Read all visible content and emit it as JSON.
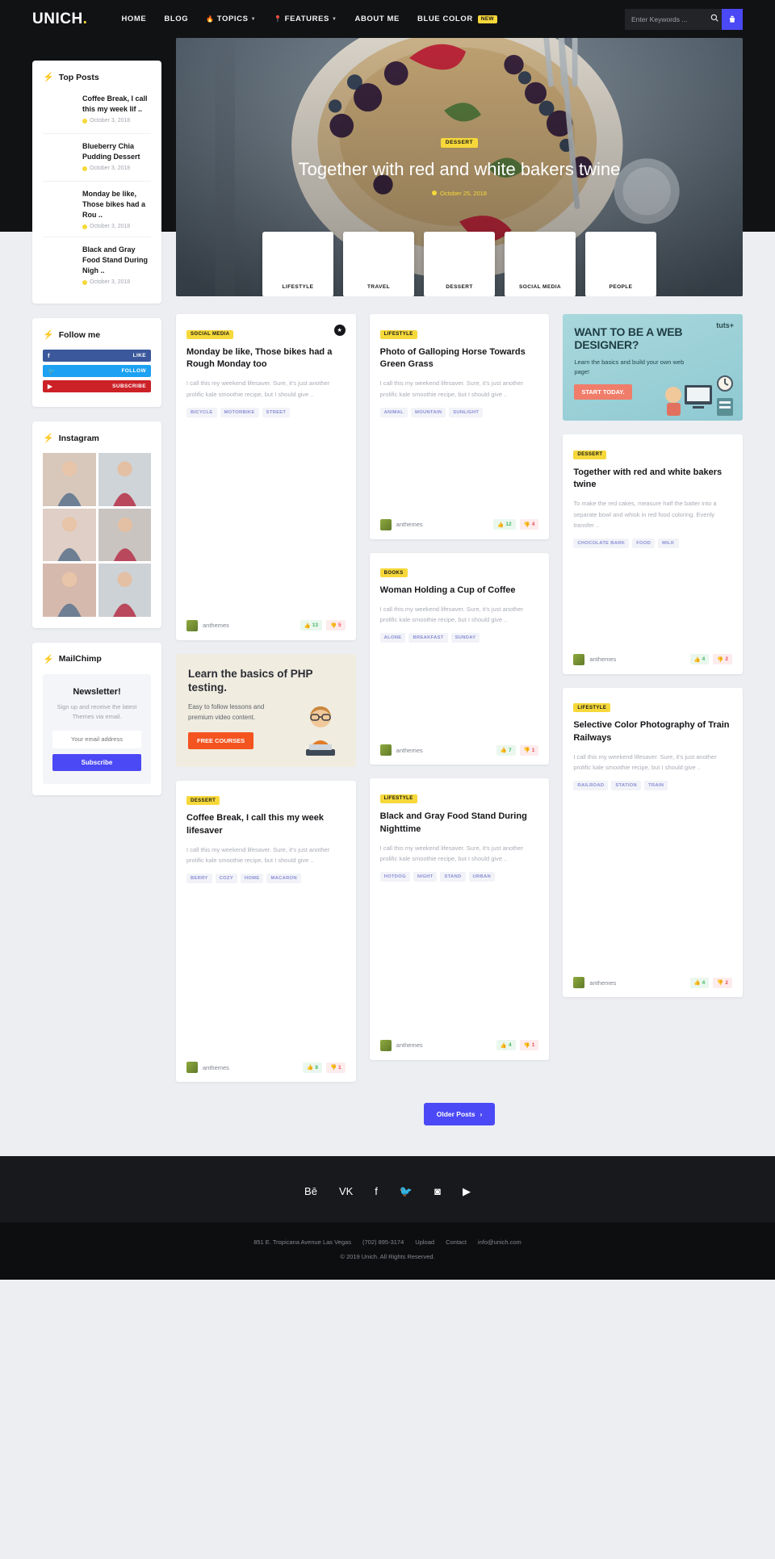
{
  "header": {
    "logo": "UNICH",
    "logo_dot": ".",
    "nav": [
      {
        "label": "HOME",
        "icon": "",
        "caret": false,
        "badge": ""
      },
      {
        "label": "BLOG",
        "icon": "",
        "caret": false,
        "badge": ""
      },
      {
        "label": "TOPICS",
        "icon": "flame-icon",
        "caret": true,
        "badge": ""
      },
      {
        "label": "FEATURES",
        "icon": "pin-icon",
        "caret": true,
        "badge": ""
      },
      {
        "label": "ABOUT ME",
        "icon": "",
        "caret": false,
        "badge": ""
      },
      {
        "label": "BLUE COLOR",
        "icon": "",
        "caret": false,
        "badge": "NEW"
      }
    ],
    "search_placeholder": "Enter Keywords ...",
    "search_value": "",
    "accent": "#4b49f5",
    "yellow": "#f6d83a"
  },
  "sidebar": {
    "top_posts": {
      "title": "Top Posts",
      "items": [
        {
          "title": "Coffee Break, I call this my week lif ..",
          "date": "October 3, 2018"
        },
        {
          "title": "Blueberry Chia Pudding Dessert",
          "date": "October 3, 2018"
        },
        {
          "title": "Monday be like, Those bikes had a Rou ..",
          "date": "October 3, 2018"
        },
        {
          "title": "Black and Gray Food Stand During Nigh ..",
          "date": "October 3, 2018"
        }
      ]
    },
    "follow": {
      "title": "Follow me",
      "buttons": [
        {
          "network": "facebook",
          "label": "LIKE",
          "glyph": "f"
        },
        {
          "network": "twitter",
          "label": "FOLLOW",
          "glyph": "t"
        },
        {
          "network": "youtube",
          "label": "SUBSCRIBE",
          "glyph": "y"
        }
      ]
    },
    "instagram": {
      "title": "Instagram",
      "count": 6
    },
    "mailchimp": {
      "title": "MailChimp",
      "heading": "Newsletter!",
      "sub": "Sign up and receive the latest Themes via email.",
      "placeholder": "Your email address",
      "value": "",
      "button": "Subscribe"
    }
  },
  "hero": {
    "category": "DESSERT",
    "title": "Together with red and white bakers twine",
    "date": "October 25, 2018",
    "thumbs": [
      {
        "label": "LIFESTYLE"
      },
      {
        "label": "TRAVEL"
      },
      {
        "label": "DESSERT"
      },
      {
        "label": "SOCIAL MEDIA"
      },
      {
        "label": "PEOPLE"
      }
    ]
  },
  "posts": {
    "col1": [
      {
        "category": "SOCIAL MEDIA",
        "title": "Monday be like, Those bikes had a Rough Monday too",
        "excerpt": "I call this my weekend lifesaver. Sure, it's just another prolific kale smoothie recipe, but I should give ..",
        "tags": [
          "BICYCLE",
          "MOTORBIKE",
          "STREET"
        ],
        "author": "anthemes",
        "likes": "13",
        "dislikes": "5",
        "bookmark": true
      },
      {
        "category": "DESSERT",
        "title": "Coffee Break, I call this my week lifesaver",
        "excerpt": "I call this my weekend lifesaver. Sure, it's just another prolific kale smoothie recipe, but I should give ..",
        "tags": [
          "BERRY",
          "COZY",
          "HOME",
          "MACARON"
        ],
        "author": "anthemes",
        "likes": "8",
        "dislikes": "1",
        "bookmark": false
      }
    ],
    "col2": [
      {
        "category": "LIFESTYLE",
        "title": "Photo of Galloping Horse Towards Green Grass",
        "excerpt": "I call this my weekend lifesaver. Sure, it's just another prolific kale smoothie recipe, but I should give ..",
        "tags": [
          "ANIMAL",
          "MOUNTAIN",
          "SUNLIGHT"
        ],
        "author": "anthemes",
        "likes": "12",
        "dislikes": "4",
        "bookmark": false
      },
      {
        "category": "BOOKS",
        "title": "Woman Holding a Cup of Coffee",
        "excerpt": "I call this my weekend lifesaver. Sure, it's just another prolific kale smoothie recipe, but I should give ..",
        "tags": [
          "ALONE",
          "BREAKFAST",
          "SUNDAY"
        ],
        "author": "anthemes",
        "likes": "7",
        "dislikes": "1",
        "bookmark": false
      },
      {
        "category": "LIFESTYLE",
        "title": "Black and Gray Food Stand During Nighttime",
        "excerpt": "I call this my weekend lifesaver. Sure, it's just another prolific kale smoothie recipe, but I should give ..",
        "tags": [
          "HOTDOG",
          "NIGHT",
          "STAND",
          "URBAN"
        ],
        "author": "anthemes",
        "likes": "4",
        "dislikes": "1",
        "bookmark": false
      }
    ],
    "col3": [
      {
        "category": "DESSERT",
        "title": "Together with red and white bakers twine",
        "excerpt": "To make the red cakes, measure half the batter into a separate bowl and whisk in red food coloring. Evenly transfer ..",
        "tags": [
          "CHOCOLATE BARK",
          "FOOD",
          "MILK"
        ],
        "author": "anthemes",
        "likes": "4",
        "dislikes": "2",
        "bookmark": false
      },
      {
        "category": "LIFESTYLE",
        "title": "Selective Color Photography of Train Railways",
        "excerpt": "I call this my weekend lifesaver. Sure, it's just another prolific kale smoothie recipe, but I should give ..",
        "tags": [
          "RAILROAD",
          "STATION",
          "TRAIN"
        ],
        "author": "anthemes",
        "likes": "4",
        "dislikes": "2",
        "bookmark": false
      }
    ]
  },
  "promos": {
    "php": {
      "title": "Learn the basics of PHP testing.",
      "sub": "Easy to follow lessons and premium video content.",
      "button": "FREE COURSES"
    },
    "tuts": {
      "logo": "tuts+",
      "title": "WANT TO BE A WEB DESIGNER?",
      "sub": "Learn the basics and build your own web page!",
      "button": "START TODAY."
    }
  },
  "pagination": {
    "older": "Older Posts",
    "arrow": "›"
  },
  "footer": {
    "socials": [
      {
        "name": "behance-icon",
        "glyph": "Bē"
      },
      {
        "name": "vk-icon",
        "glyph": "VK"
      },
      {
        "name": "facebook-icon",
        "glyph": "f"
      },
      {
        "name": "twitter-icon",
        "glyph": "t"
      },
      {
        "name": "instagram-icon",
        "glyph": "ig"
      },
      {
        "name": "youtube-icon",
        "glyph": "yt"
      }
    ],
    "address": "851 E. Tropicana Avenue Las Vegas",
    "phone": "(702) 895-3174",
    "link_upload": "Upload",
    "link_contact": "Contact",
    "email": "info@unich.com",
    "copyright": "© 2019 Unich. All Rights Reserved."
  }
}
